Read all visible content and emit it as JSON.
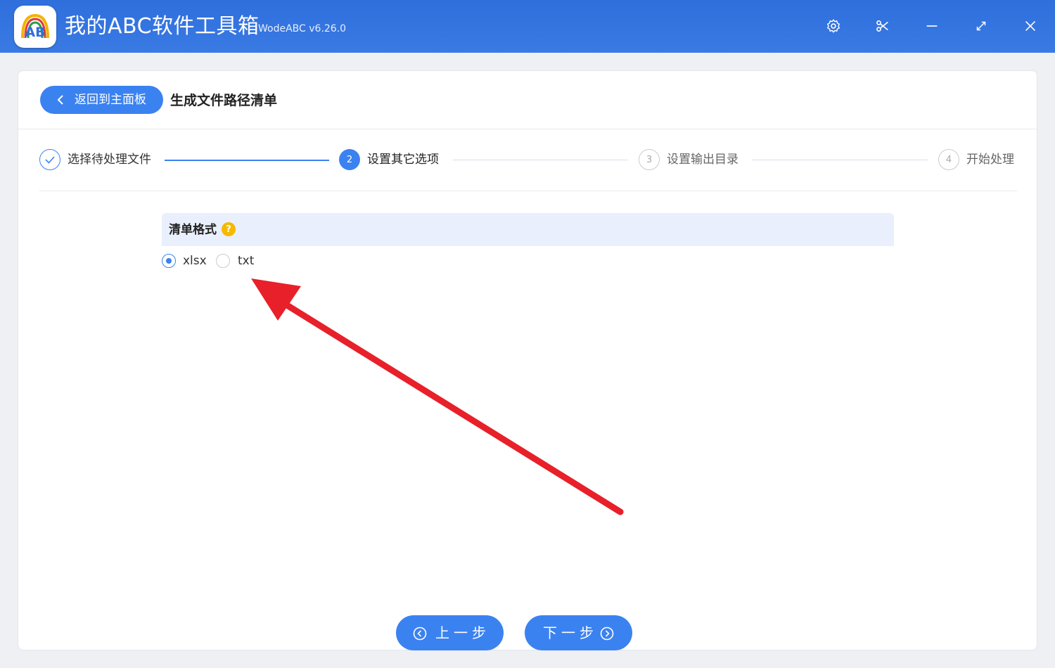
{
  "app": {
    "title": "我的ABC软件工具箱",
    "version": "WodeABC v6.26.0",
    "logo_text": "AB",
    "window_controls": [
      "settings-icon",
      "scissors-icon",
      "minimize-icon",
      "maximize-icon",
      "close-icon"
    ]
  },
  "header": {
    "back_label": "返回到主面板",
    "page_title": "生成文件路径清单"
  },
  "steps": [
    {
      "number": "1",
      "label": "选择待处理文件",
      "state": "done"
    },
    {
      "number": "2",
      "label": "设置其它选项",
      "state": "active"
    },
    {
      "number": "3",
      "label": "设置输出目录",
      "state": "pending"
    },
    {
      "number": "4",
      "label": "开始处理",
      "state": "pending"
    }
  ],
  "options": {
    "section_title": "清单格式",
    "help_glyph": "?",
    "choices": [
      {
        "label": "xlsx",
        "selected": true
      },
      {
        "label": "txt",
        "selected": false
      }
    ]
  },
  "footer": {
    "prev_label": "上一步",
    "next_label": "下一步"
  },
  "colors": {
    "titlebar": "#2f6fdc",
    "accent": "#3b82f1",
    "help": "#f6b800",
    "annotation_arrow": "#e8202a"
  }
}
